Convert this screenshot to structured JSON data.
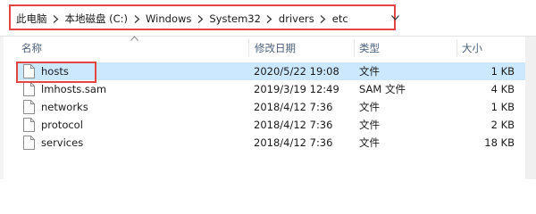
{
  "address": {
    "crumbs": [
      "此电脑",
      "本地磁盘 (C:)",
      "Windows",
      "System32",
      "drivers",
      "etc"
    ]
  },
  "columns": {
    "name": "名称",
    "date": "修改日期",
    "type": "类型",
    "size": "大小"
  },
  "files": [
    {
      "name": "hosts",
      "date": "2020/5/22 19:08",
      "type": "文件",
      "size": "1 KB",
      "selected": true
    },
    {
      "name": "lmhosts.sam",
      "date": "2019/3/19 12:49",
      "type": "SAM 文件",
      "size": "4 KB"
    },
    {
      "name": "networks",
      "date": "2018/4/12 7:36",
      "type": "文件",
      "size": "1 KB"
    },
    {
      "name": "protocol",
      "date": "2018/4/12 7:36",
      "type": "文件",
      "size": "2 KB"
    },
    {
      "name": "services",
      "date": "2018/4/12 7:36",
      "type": "文件",
      "size": "18 KB"
    }
  ],
  "colors": {
    "selection": "#cce8ff",
    "highlight_border": "#e64545",
    "header_text": "#4c607a"
  }
}
